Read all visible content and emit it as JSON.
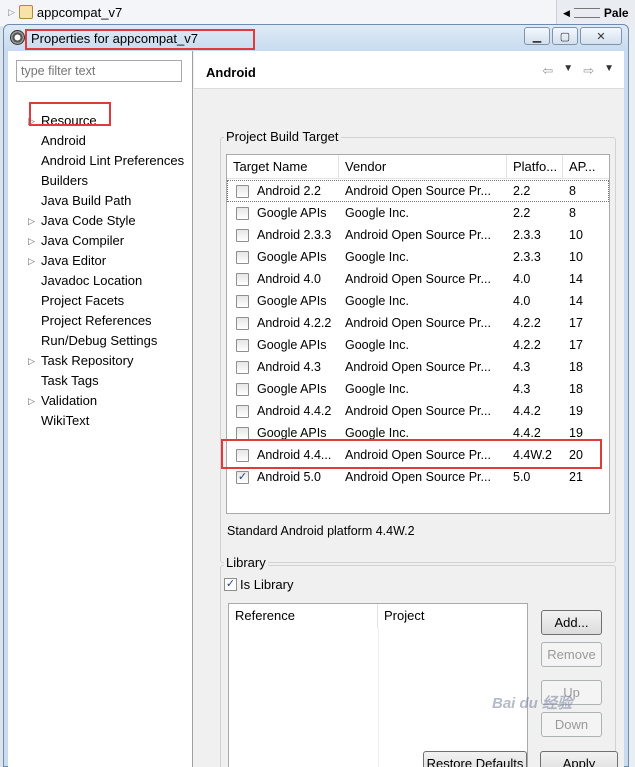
{
  "background": {
    "tab_label": "appcompat_v7",
    "right_view_label": "Pale"
  },
  "dialog": {
    "title": "Properties for appcompat_v7"
  },
  "sidebar": {
    "filter_placeholder": "type filter text",
    "items": [
      {
        "label": "Resource",
        "expandable": true
      },
      {
        "label": "Android",
        "expandable": false,
        "selected": true
      },
      {
        "label": "Android Lint Preferences",
        "expandable": false
      },
      {
        "label": "Builders",
        "expandable": false
      },
      {
        "label": "Java Build Path",
        "expandable": false
      },
      {
        "label": "Java Code Style",
        "expandable": true
      },
      {
        "label": "Java Compiler",
        "expandable": true
      },
      {
        "label": "Java Editor",
        "expandable": true
      },
      {
        "label": "Javadoc Location",
        "expandable": false
      },
      {
        "label": "Project Facets",
        "expandable": false
      },
      {
        "label": "Project References",
        "expandable": false
      },
      {
        "label": "Run/Debug Settings",
        "expandable": false
      },
      {
        "label": "Task Repository",
        "expandable": true
      },
      {
        "label": "Task Tags",
        "expandable": false
      },
      {
        "label": "Validation",
        "expandable": true
      },
      {
        "label": "WikiText",
        "expandable": false
      }
    ]
  },
  "page": {
    "title": "Android"
  },
  "build_target": {
    "group_label": "Project Build Target",
    "columns": [
      "Target Name",
      "Vendor",
      "Platfo...",
      "AP..."
    ],
    "rows": [
      {
        "name": "Android 2.2",
        "vendor": "Android Open Source Pr...",
        "platform": "2.2",
        "api": "8",
        "checked": false
      },
      {
        "name": "Google APIs",
        "vendor": "Google Inc.",
        "platform": "2.2",
        "api": "8",
        "checked": false
      },
      {
        "name": "Android 2.3.3",
        "vendor": "Android Open Source Pr...",
        "platform": "2.3.3",
        "api": "10",
        "checked": false
      },
      {
        "name": "Google APIs",
        "vendor": "Google Inc.",
        "platform": "2.3.3",
        "api": "10",
        "checked": false
      },
      {
        "name": "Android 4.0",
        "vendor": "Android Open Source Pr...",
        "platform": "4.0",
        "api": "14",
        "checked": false
      },
      {
        "name": "Google APIs",
        "vendor": "Google Inc.",
        "platform": "4.0",
        "api": "14",
        "checked": false
      },
      {
        "name": "Android 4.2.2",
        "vendor": "Android Open Source Pr...",
        "platform": "4.2.2",
        "api": "17",
        "checked": false
      },
      {
        "name": "Google APIs",
        "vendor": "Google Inc.",
        "platform": "4.2.2",
        "api": "17",
        "checked": false
      },
      {
        "name": "Android 4.3",
        "vendor": "Android Open Source Pr...",
        "platform": "4.3",
        "api": "18",
        "checked": false
      },
      {
        "name": "Google APIs",
        "vendor": "Google Inc.",
        "platform": "4.3",
        "api": "18",
        "checked": false
      },
      {
        "name": "Android 4.4.2",
        "vendor": "Android Open Source Pr...",
        "platform": "4.4.2",
        "api": "19",
        "checked": false
      },
      {
        "name": "Google APIs",
        "vendor": "Google Inc.",
        "platform": "4.4.2",
        "api": "19",
        "checked": false
      },
      {
        "name": "Android 4.4...",
        "vendor": "Android Open Source Pr...",
        "platform": "4.4W.2",
        "api": "20",
        "checked": false
      },
      {
        "name": "Android 5.0",
        "vendor": "Android Open Source Pr...",
        "platform": "5.0",
        "api": "21",
        "checked": true
      }
    ],
    "description": "Standard Android platform 4.4W.2"
  },
  "library": {
    "group_label": "Library",
    "is_library_label": "Is Library",
    "is_library_checked": true,
    "columns": [
      "Reference",
      "Project"
    ],
    "buttons": {
      "add": "Add...",
      "remove": "Remove",
      "up": "Up",
      "down": "Down"
    }
  },
  "footer": {
    "restore_defaults": "Restore Defaults",
    "apply": "Apply"
  },
  "icons": {
    "check_glyph": "✓",
    "back": "⇦",
    "forward": "⇨",
    "menu": "▼",
    "expand": "▷"
  },
  "colors": {
    "annotation_red": "#e03a3a",
    "title_gradient_top": "#dfeaf6",
    "title_gradient_bottom": "#c7dbef"
  }
}
